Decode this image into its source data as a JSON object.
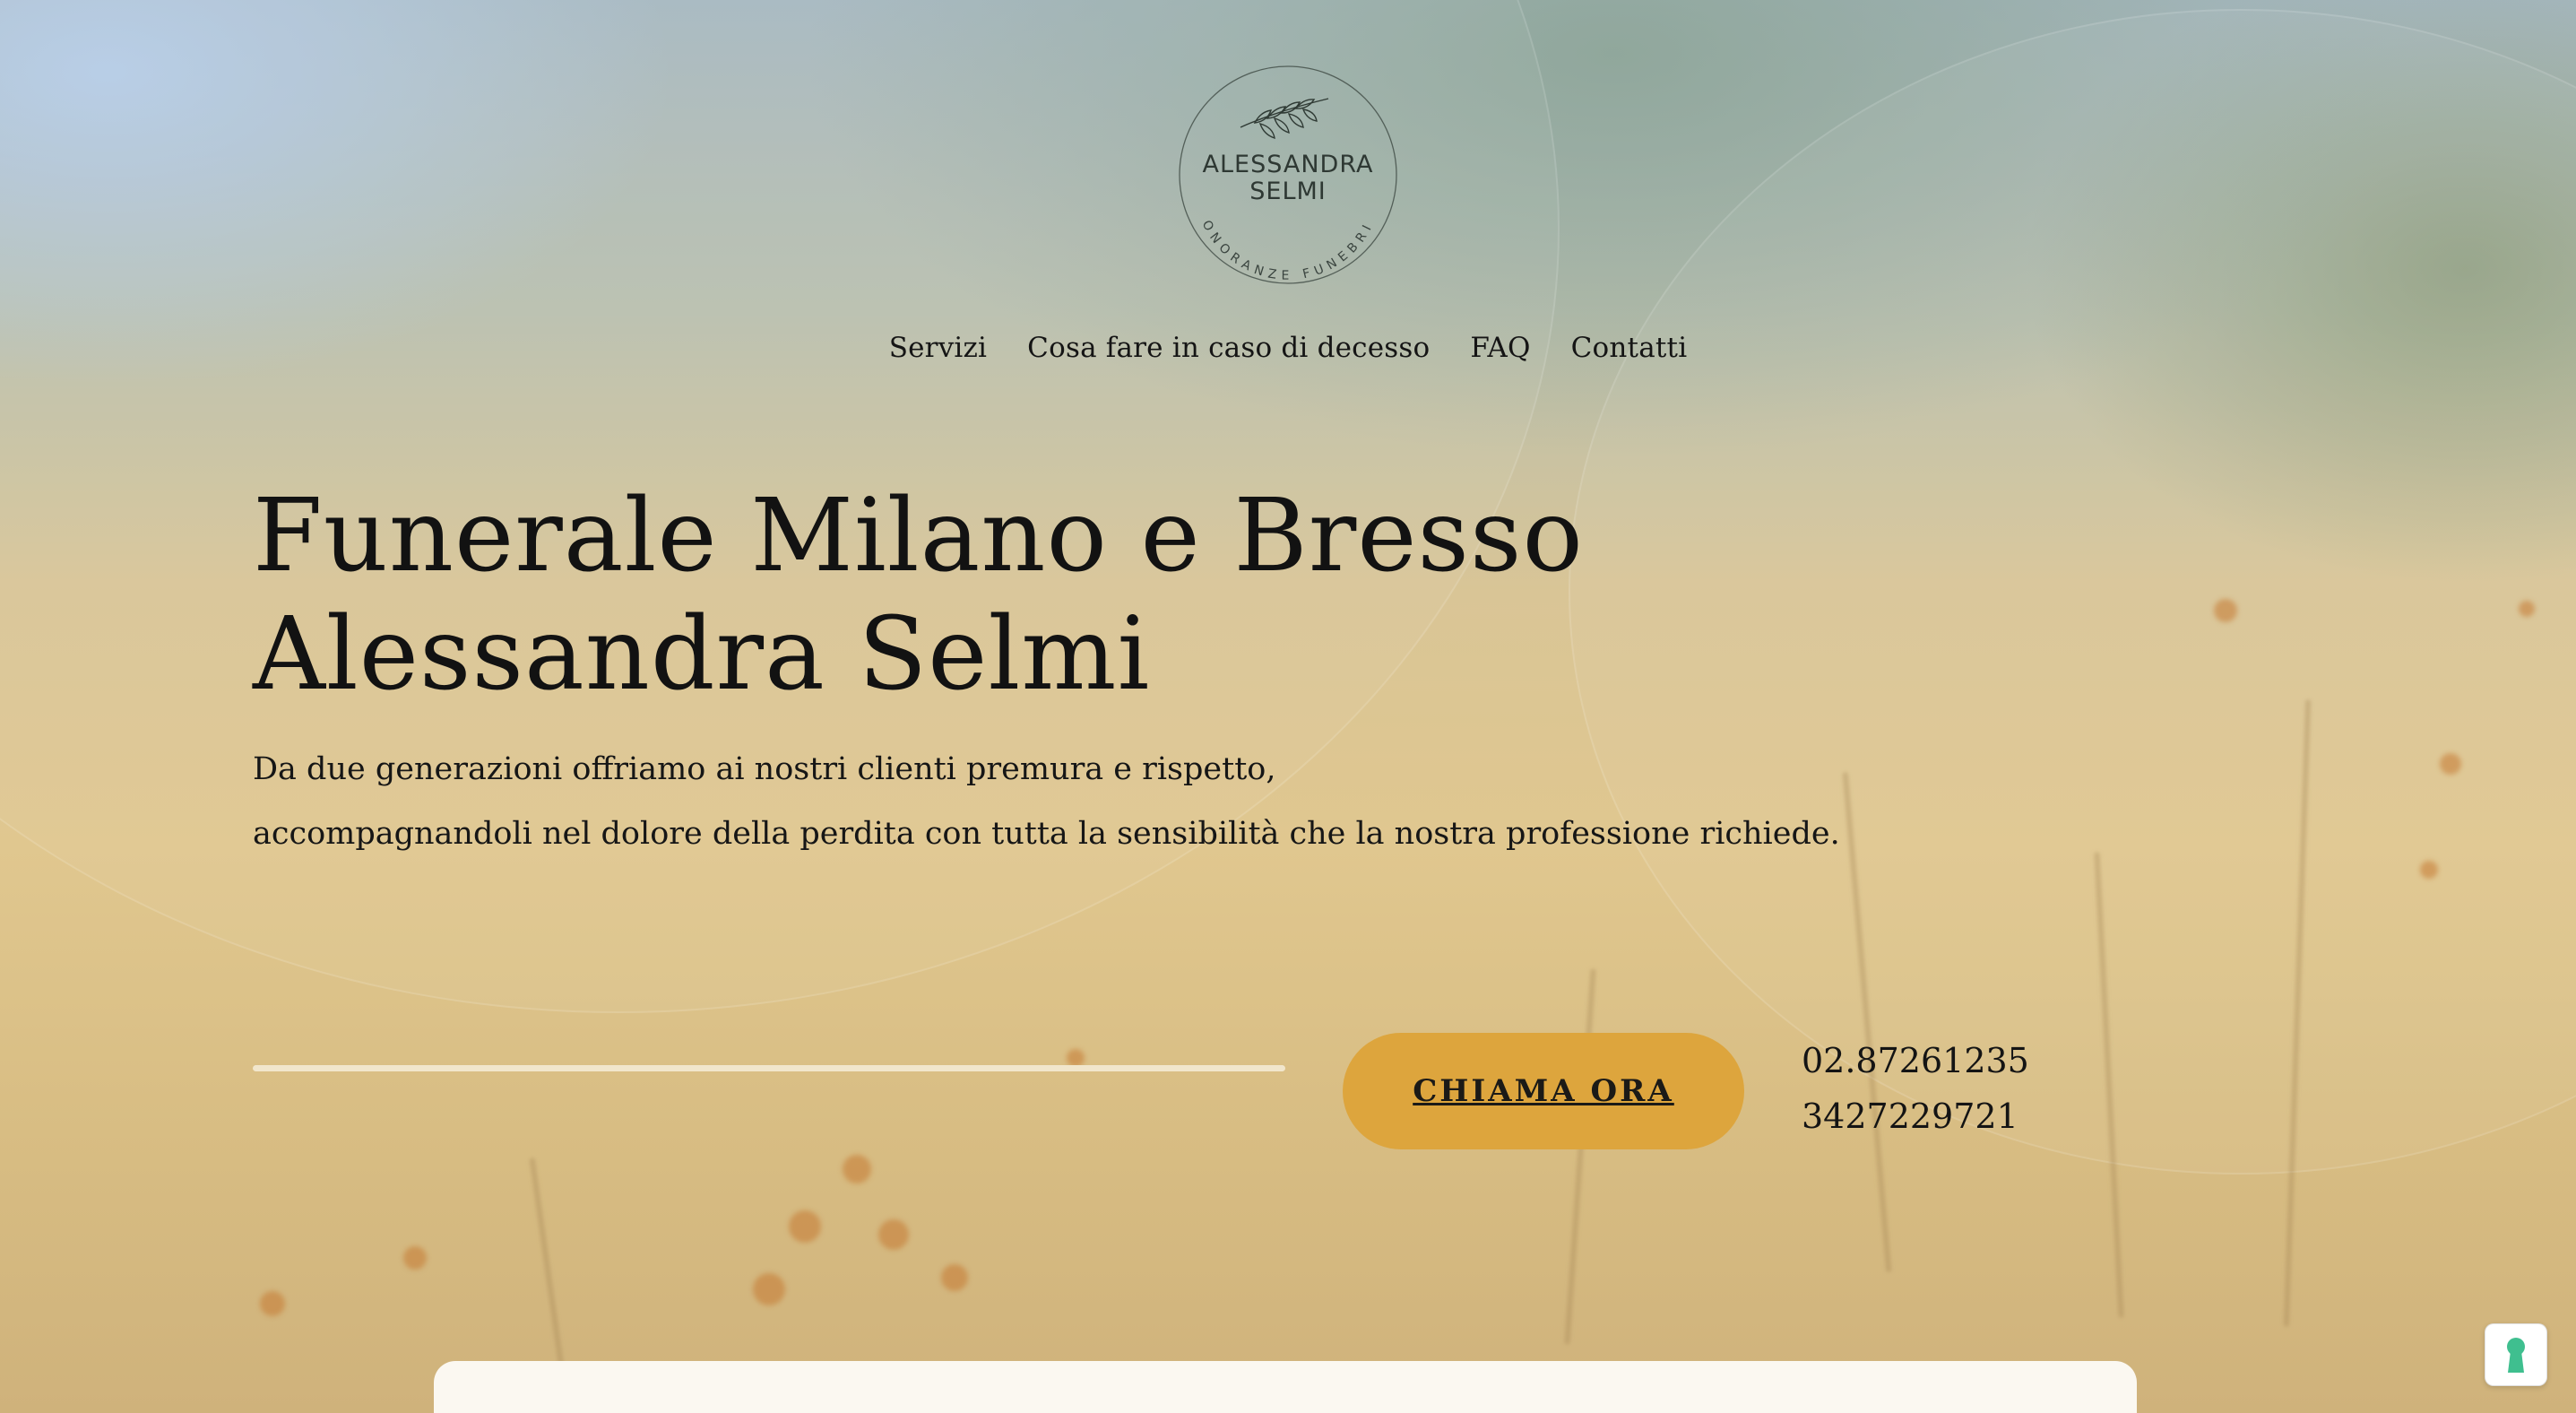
{
  "brand": {
    "logo_name": "ALESSANDRA",
    "logo_surname": "SELMI",
    "logo_tagline": "ONORANZE FUNEBRI",
    "icon": "olive-branch-icon"
  },
  "nav": {
    "items": [
      {
        "label": "Servizi"
      },
      {
        "label": "Cosa fare in caso di decesso"
      },
      {
        "label": "FAQ"
      },
      {
        "label": "Contatti"
      }
    ]
  },
  "hero": {
    "title_line1": "Funerale Milano e Bresso",
    "title_line2": "Alessandra Selmi",
    "lead_line1": "Da due generazioni offriamo ai nostri clienti premura e rispetto,",
    "lead_line2": "accompagnandoli nel dolore della perdita con tutta la sensibilità che la nostra professione richiede.",
    "progress_fraction": 1.0,
    "cta_label": "CHIAMA ORA",
    "phones": [
      "02.87261235",
      "3427229721"
    ]
  },
  "colors": {
    "accent": "#dda53d",
    "text": "#111111",
    "card": "#fbf8f1",
    "cookie_icon": "#3fbf8f"
  },
  "widgets": {
    "cookie_icon": "keyhole-icon"
  }
}
